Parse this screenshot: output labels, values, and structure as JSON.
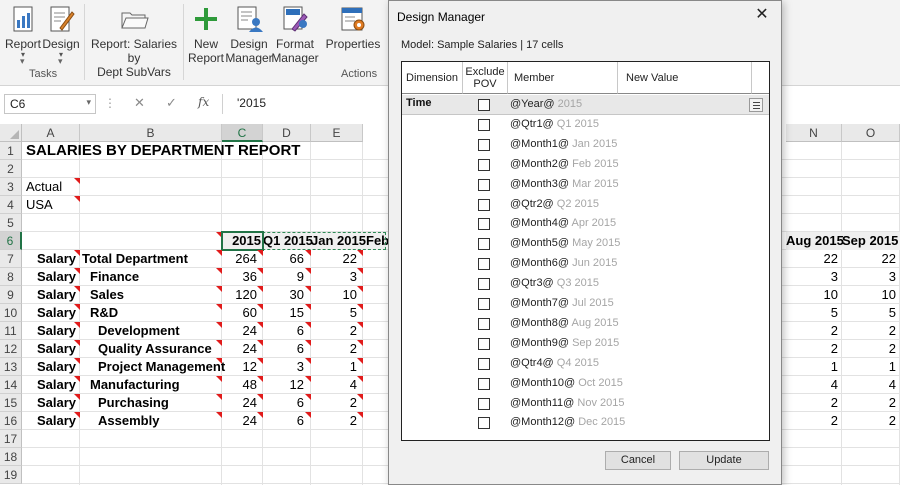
{
  "ribbon": {
    "buttons": [
      {
        "label": "Report",
        "dropdown": true
      },
      {
        "label": "Design",
        "dropdown": true
      },
      {
        "label": "Report: Salaries by\nDept SubVars",
        "dropdown": true
      },
      {
        "label": "New\nReport",
        "dropdown": false
      },
      {
        "label": "Design\nManager",
        "dropdown": false
      },
      {
        "label": "Format\nManager",
        "dropdown": false
      },
      {
        "label": "Properties",
        "dropdown": false
      }
    ],
    "groups": {
      "tasks": "Tasks",
      "actions": "Actions"
    },
    "accent_green": "#217346"
  },
  "formula_bar": {
    "name_box": "C6",
    "value": "'2015"
  },
  "sheet": {
    "columns": [
      "A",
      "B",
      "C",
      "D",
      "E",
      "N",
      "O"
    ],
    "rows": [
      "1",
      "2",
      "3",
      "4",
      "5",
      "6",
      "7",
      "8",
      "9",
      "10",
      "11",
      "12",
      "13",
      "14",
      "15",
      "16",
      "17",
      "18",
      "19"
    ],
    "title": "SALARIES BY DEPARTMENT REPORT",
    "a3": "Actual",
    "a4": "USA",
    "header_row": {
      "c": "2015",
      "d": "Q1 2015",
      "e": "Jan 2015",
      "f_partial": "Feb",
      "n": "Aug 2015",
      "o": "Sep 2015"
    },
    "data_rows": [
      {
        "a": "Salary",
        "b": "Total Department",
        "indent": 0,
        "c": "264",
        "d": "66",
        "e": "22",
        "n": "22",
        "o": "22"
      },
      {
        "a": "Salary",
        "b": "Finance",
        "indent": 1,
        "c": "36",
        "d": "9",
        "e": "3",
        "n": "3",
        "o": "3"
      },
      {
        "a": "Salary",
        "b": "Sales",
        "indent": 1,
        "c": "120",
        "d": "30",
        "e": "10",
        "n": "10",
        "o": "10"
      },
      {
        "a": "Salary",
        "b": "R&D",
        "indent": 1,
        "c": "60",
        "d": "15",
        "e": "5",
        "n": "5",
        "o": "5"
      },
      {
        "a": "Salary",
        "b": "Development",
        "indent": 2,
        "c": "24",
        "d": "6",
        "e": "2",
        "n": "2",
        "o": "2"
      },
      {
        "a": "Salary",
        "b": "Quality Assurance",
        "indent": 2,
        "c": "24",
        "d": "6",
        "e": "2",
        "n": "2",
        "o": "2"
      },
      {
        "a": "Salary",
        "b": "Project Management",
        "indent": 2,
        "c": "12",
        "d": "3",
        "e": "1",
        "n": "1",
        "o": "1"
      },
      {
        "a": "Salary",
        "b": "Manufacturing",
        "indent": 1,
        "c": "48",
        "d": "12",
        "e": "4",
        "n": "4",
        "o": "4"
      },
      {
        "a": "Salary",
        "b": "Purchasing",
        "indent": 2,
        "c": "24",
        "d": "6",
        "e": "2",
        "n": "2",
        "o": "2"
      },
      {
        "a": "Salary",
        "b": "Assembly",
        "indent": 2,
        "c": "24",
        "d": "6",
        "e": "2",
        "n": "2",
        "o": "2"
      }
    ]
  },
  "dialog": {
    "title": "Design Manager",
    "model": "Model: Sample Salaries | 17 cells",
    "headers": {
      "dimension": "Dimension",
      "exclude_pov": "Exclude\nPOV",
      "member": "Member",
      "new_value": "New Value"
    },
    "dimension": "Time",
    "members": [
      {
        "var": "@Year@",
        "alias": "2015"
      },
      {
        "var": "@Qtr1@",
        "alias": "Q1 2015"
      },
      {
        "var": "@Month1@",
        "alias": "Jan 2015"
      },
      {
        "var": "@Month2@",
        "alias": "Feb 2015"
      },
      {
        "var": "@Month3@",
        "alias": "Mar 2015"
      },
      {
        "var": "@Qtr2@",
        "alias": "Q2 2015"
      },
      {
        "var": "@Month4@",
        "alias": "Apr 2015"
      },
      {
        "var": "@Month5@",
        "alias": "May 2015"
      },
      {
        "var": "@Month6@",
        "alias": "Jun 2015"
      },
      {
        "var": "@Qtr3@",
        "alias": "Q3 2015"
      },
      {
        "var": "@Month7@",
        "alias": "Jul 2015"
      },
      {
        "var": "@Month8@",
        "alias": "Aug 2015"
      },
      {
        "var": "@Month9@",
        "alias": "Sep 2015"
      },
      {
        "var": "@Qtr4@",
        "alias": "Q4 2015"
      },
      {
        "var": "@Month10@",
        "alias": "Oct 2015"
      },
      {
        "var": "@Month11@",
        "alias": "Nov 2015"
      },
      {
        "var": "@Month12@",
        "alias": "Dec 2015"
      }
    ],
    "cancel": "Cancel",
    "update": "Update"
  }
}
